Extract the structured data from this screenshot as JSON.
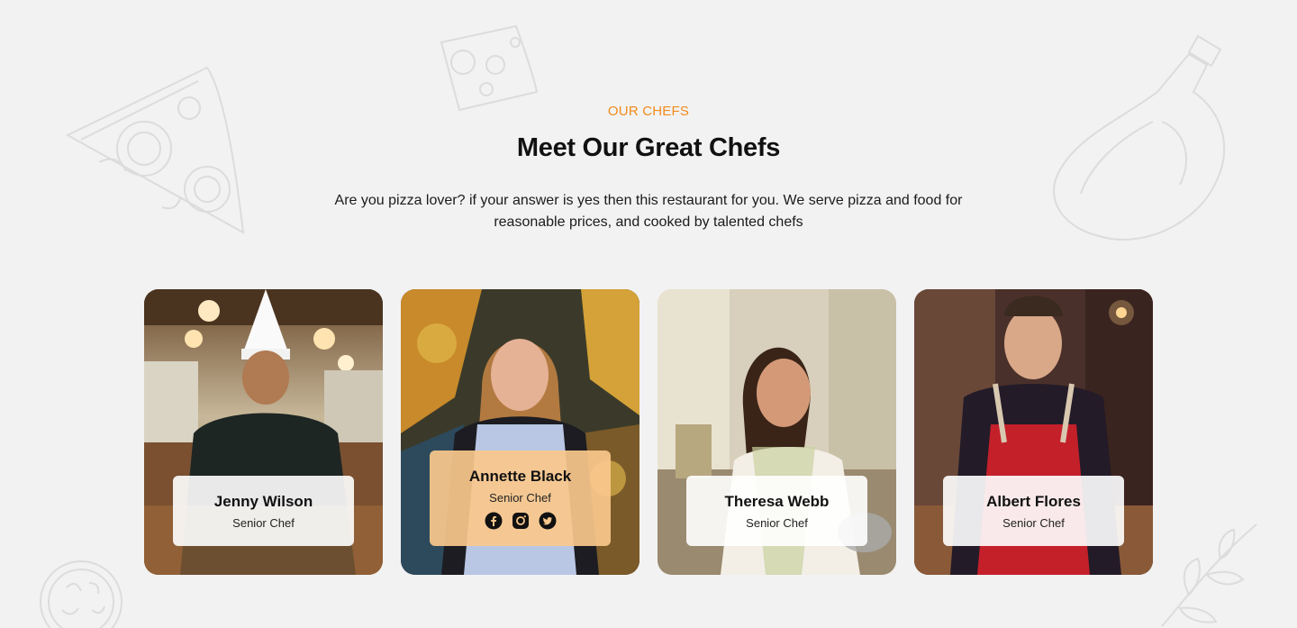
{
  "section": {
    "eyebrow": "OUR CHEFS",
    "title": "Meet Our Great Chefs",
    "description": "Are you pizza lover? if your answer is yes then this restaurant for you. We serve pizza and food for reasonable prices, and cooked by talented chefs"
  },
  "chefs": [
    {
      "name": "Jenny Wilson",
      "role": "Senior Chef"
    },
    {
      "name": "Annette Black",
      "role": "Senior Chef",
      "socials": [
        "facebook-icon",
        "instagram-icon",
        "twitter-icon"
      ]
    },
    {
      "name": "Theresa Webb",
      "role": "Senior Chef"
    },
    {
      "name": "Albert Flores",
      "role": "Senior Chef"
    }
  ],
  "colors": {
    "accent": "#f28a1c",
    "background": "#f2f2f2",
    "active_card_overlay": "#fac88c"
  }
}
